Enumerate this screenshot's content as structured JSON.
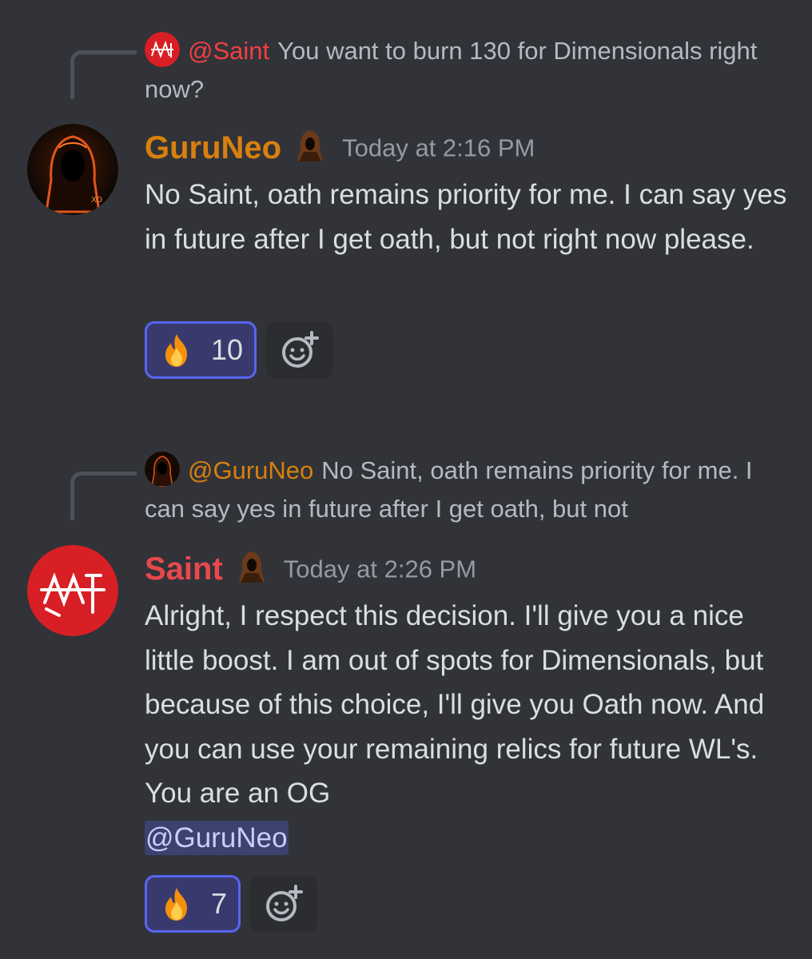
{
  "messages": [
    {
      "reply": {
        "mention": "@Saint",
        "text": "You want to burn 130 for Dimensionals right now?"
      },
      "author": "GuruNeo",
      "timestamp": "Today at 2:16 PM",
      "content": "No Saint, oath remains priority for me. I can say yes in future after I get oath, but not right now please.",
      "reaction": {
        "emoji": "fire-emoji",
        "count": "10"
      }
    },
    {
      "reply": {
        "mention": "@GuruNeo",
        "text": "No Saint, oath remains priority for me. I can say yes in future after I get oath, but not"
      },
      "author": "Saint",
      "timestamp": "Today at 2:26 PM",
      "content": "Alright, I respect this decision. I'll give you a nice little boost. I am out of spots for Dimensionals, but because of this choice, I'll give you Oath now. And you can use your remaining relics for future WL's. You are an OG",
      "content_mention": "@GuruNeo",
      "reaction": {
        "emoji": "fire-emoji",
        "count": "7"
      }
    }
  ],
  "colors": {
    "background": "#313338",
    "guru_name": "#d8800e",
    "saint_name": "#e8484c",
    "reaction_border": "#5865f2",
    "mention_chip": "#3c4270"
  }
}
